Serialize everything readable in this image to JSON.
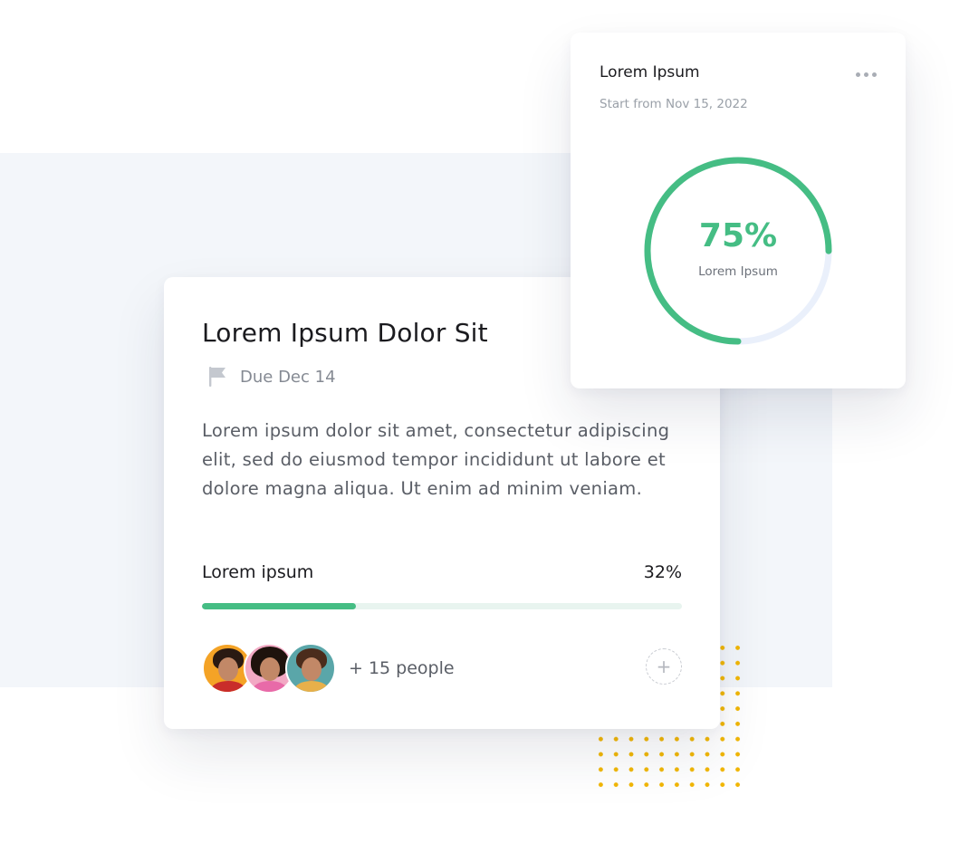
{
  "task_card": {
    "title": "Lorem Ipsum Dolor Sit",
    "due": "Due Dec 14",
    "description": "Lorem ipsum dolor sit amet, consectetur adipiscing elit, sed do eiusmod tempor incididunt ut labore et dolore magna aliqua. Ut enim ad minim veniam.",
    "progress": {
      "label": "Lorem ipsum",
      "percent_text": "32%",
      "value": 0.32
    },
    "people_text": "+ 15 people",
    "add_label": "+"
  },
  "stat_card": {
    "title": "Lorem Ipsum",
    "subtitle": "Start from Nov 15, 2022",
    "ring_value_text": "75%",
    "ring_label": "Lorem Ipsum",
    "ring_value": 0.75
  },
  "colors": {
    "accent_green": "#45bd84",
    "track_green": "#e8f4ef",
    "ring_track": "#eaf0fb",
    "dots_yellow": "#f2b705"
  },
  "icons": {
    "flag": "flag-icon",
    "menu": "more-horizontal-icon",
    "add": "plus-icon"
  }
}
